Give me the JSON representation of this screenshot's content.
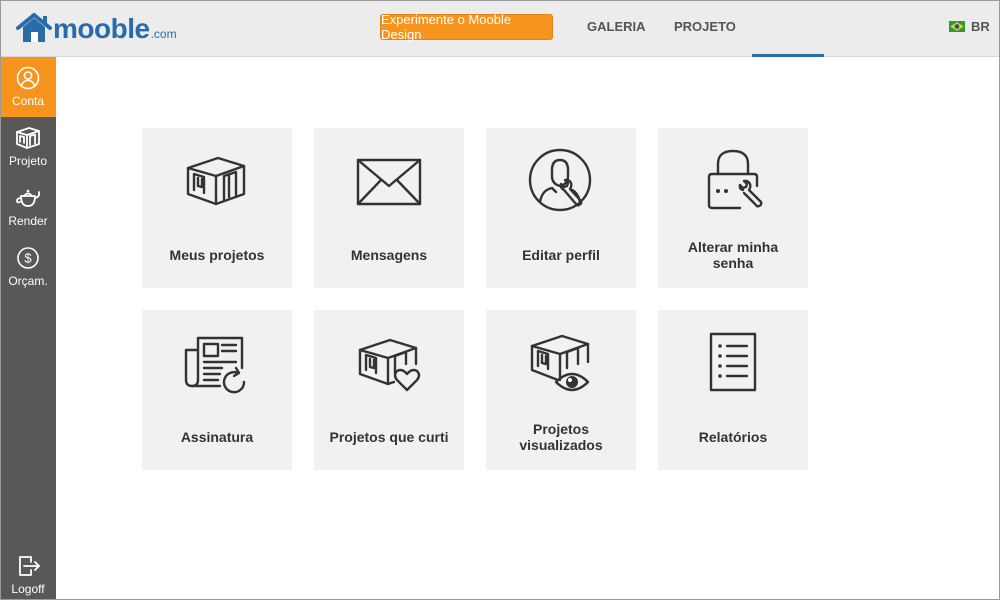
{
  "header": {
    "logo_text": "mooble",
    "logo_suffix": ".com",
    "cta_label": "Experimente o Mooble Design",
    "nav": [
      "GALERIA",
      "PROJETO"
    ],
    "language": "BR",
    "accent_color": "#f7941d",
    "brand_color": "#2a6cab"
  },
  "sidebar": {
    "items": [
      {
        "label": "Conta",
        "icon": "user-icon",
        "active": true
      },
      {
        "label": "Projeto",
        "icon": "room-icon",
        "active": false
      },
      {
        "label": "Render",
        "icon": "teapot-icon",
        "active": false
      },
      {
        "label": "Orçam.",
        "icon": "dollar-icon",
        "active": false
      }
    ],
    "logoff_label": "Logoff"
  },
  "tiles": [
    {
      "label": "Meus projetos",
      "icon": "room-icon"
    },
    {
      "label": "Mensagens",
      "icon": "envelope-icon"
    },
    {
      "label": "Editar perfil",
      "icon": "user-wrench-icon"
    },
    {
      "label": "Alterar minha senha",
      "icon": "lock-wrench-icon"
    },
    {
      "label": "Assinatura",
      "icon": "newspaper-refresh-icon"
    },
    {
      "label": "Projetos que curti",
      "icon": "room-heart-icon"
    },
    {
      "label": "Projetos visualizados",
      "icon": "room-eye-icon"
    },
    {
      "label": "Relatórios",
      "icon": "report-list-icon"
    }
  ]
}
